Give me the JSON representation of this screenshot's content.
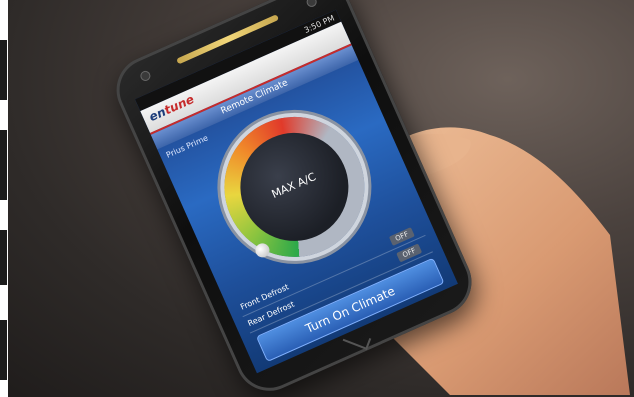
{
  "status_bar": {
    "time": "3:50 PM"
  },
  "app": {
    "logo_part1": "en",
    "logo_part2": "tune",
    "screen_title": "Remote Climate",
    "vehicle": "Prius Prime",
    "dial_label": "MAX A/C"
  },
  "controls": {
    "front_defrost": {
      "label": "Front Defrost",
      "state": "OFF"
    },
    "rear_defrost": {
      "label": "Rear Defrost",
      "state": "OFF"
    },
    "action_button": "Turn On Climate"
  },
  "colors": {
    "accent": "#c62b2b",
    "screen_blue": "#2a6ac2"
  }
}
